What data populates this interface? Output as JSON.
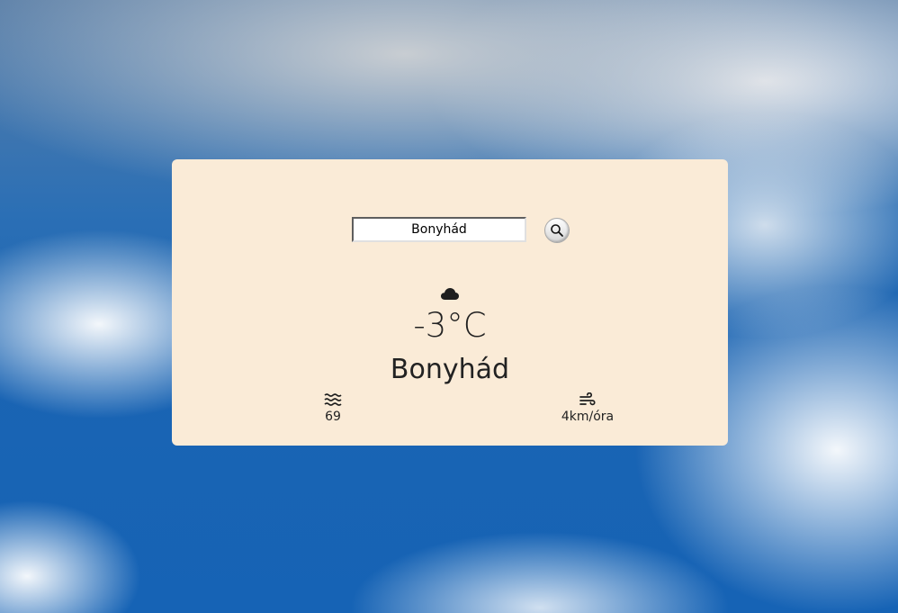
{
  "search": {
    "value": "Bonyhád",
    "button_icon": "search-icon"
  },
  "weather": {
    "condition_icon": "cloud-icon",
    "temperature": "-3°C",
    "city": "Bonyhád"
  },
  "stats": {
    "humidity": {
      "icon": "water-waves-icon",
      "value": "69"
    },
    "wind": {
      "icon": "wind-icon",
      "value": "4km/óra"
    }
  },
  "colors": {
    "card_background": "#faebd7",
    "text": "#222222"
  }
}
